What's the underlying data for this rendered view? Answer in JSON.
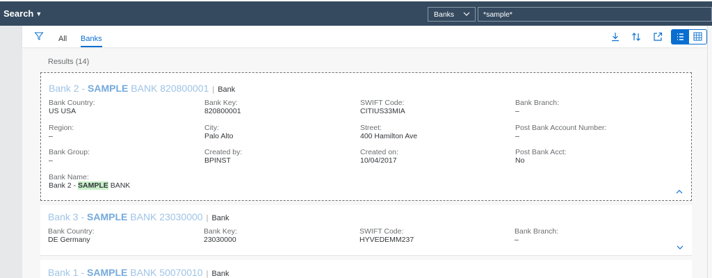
{
  "header": {
    "title": "Search",
    "scope": "Banks",
    "search_value": "*sample*"
  },
  "tabs": [
    {
      "label": "All"
    },
    {
      "label": "Banks"
    }
  ],
  "results_label": "Results (14)",
  "cards": [
    {
      "title_prefix": "Bank 2 - ",
      "title_highlight": "SAMPLE",
      "title_suffix": " BANK 820800001",
      "type": "Bank",
      "fields": [
        {
          "label": "Bank Country:",
          "value": "US USA"
        },
        {
          "label": "Bank Key:",
          "value": "820800001"
        },
        {
          "label": "SWIFT Code:",
          "value": "CITIUS33MIA"
        },
        {
          "label": "Bank Branch:",
          "value": "–"
        },
        {
          "label": "Region:",
          "value": "–"
        },
        {
          "label": "City:",
          "value": "Palo Alto"
        },
        {
          "label": "Street:",
          "value": "400 Hamilton Ave"
        },
        {
          "label": "Post Bank Account Number:",
          "value": "–"
        },
        {
          "label": "Bank Group:",
          "value": "–"
        },
        {
          "label": "Created by:",
          "value": "BPINST"
        },
        {
          "label": "Created on:",
          "value": "10/04/2017"
        },
        {
          "label": "Post Bank Acct:",
          "value": "No"
        }
      ],
      "bank_name": {
        "label": "Bank Name:",
        "prefix": "Bank 2 - ",
        "highlight": "SAMPLE",
        "suffix": " BANK"
      }
    },
    {
      "title_prefix": "Bank 3 - ",
      "title_highlight": "SAMPLE",
      "title_suffix": " BANK 23030000",
      "type": "Bank",
      "fields": [
        {
          "label": "Bank Country:",
          "value": "DE Germany"
        },
        {
          "label": "Bank Key:",
          "value": "23030000"
        },
        {
          "label": "SWIFT Code:",
          "value": "HYVEDEMM237"
        },
        {
          "label": "Bank Branch:",
          "value": "–"
        }
      ]
    },
    {
      "title_prefix": "Bank 1 - ",
      "title_highlight": "SAMPLE",
      "title_suffix": " BANK 50070010",
      "type": "Bank"
    }
  ],
  "icons": {
    "filter": "filter-icon",
    "download": "download-icon",
    "sort": "sort-icon",
    "share": "share-icon",
    "list_view": "list-view-icon",
    "grid_view": "grid-view-icon",
    "collapse": "chevron-up-icon",
    "expand": "chevron-down-icon"
  },
  "colors": {
    "shell": "#354a5f",
    "accent": "#0a6ed1",
    "title_link": "#9ec3e6",
    "highlight_bg": "#c9f0c9"
  }
}
